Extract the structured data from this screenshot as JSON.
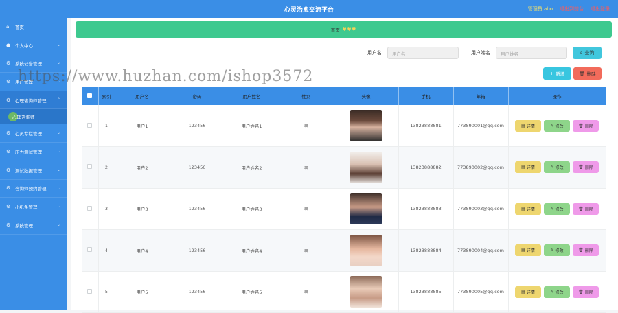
{
  "header": {
    "title": "心灵治愈交流平台",
    "admin": "管理员 abo",
    "link1": "退出到前台",
    "link2": "退出登录"
  },
  "sidebar": {
    "items": [
      {
        "label": "首页",
        "icon": "home-icon"
      },
      {
        "label": "个人中心",
        "icon": "user-icon"
      },
      {
        "label": "系统公告管理",
        "icon": "gear-icon"
      },
      {
        "label": "用户管理",
        "icon": "gear-icon"
      },
      {
        "label": "心理咨询师管理",
        "icon": "gear-icon"
      }
    ],
    "sub_item": "心理咨询师",
    "items_after": [
      {
        "label": "心灵专栏管理",
        "icon": "gear-icon"
      },
      {
        "label": "压力测试管理",
        "icon": "gear-icon"
      },
      {
        "label": "测试数据管理",
        "icon": "gear-icon"
      },
      {
        "label": "咨询师预约管理",
        "icon": "gear-icon"
      },
      {
        "label": "小纸条管理",
        "icon": "gear-icon"
      },
      {
        "label": "系统管理",
        "icon": "gear-icon"
      }
    ]
  },
  "breadcrumb": {
    "label": "首页"
  },
  "search": {
    "username_label": "用户名",
    "username_placeholder": "用户名",
    "name_label": "用户姓名",
    "name_placeholder": "用户姓名",
    "query_button": "查询"
  },
  "toolbar": {
    "add": "新增",
    "delete": "删除"
  },
  "watermark": "https://www.huzhan.com/ishop3572",
  "table": {
    "headers": [
      "",
      "索引",
      "用户名",
      "密码",
      "用户姓名",
      "性别",
      "头像",
      "手机",
      "邮箱",
      "操作"
    ],
    "op_labels": {
      "detail": "详情",
      "edit": "修改",
      "delete": "删除"
    },
    "rows": [
      {
        "index": "1",
        "username": "用户1",
        "password": "123456",
        "name": "用户姓名1",
        "gender": "男",
        "phone": "13823888881",
        "email": "773890001@qq.com"
      },
      {
        "index": "2",
        "username": "用户2",
        "password": "123456",
        "name": "用户姓名2",
        "gender": "男",
        "phone": "13823888882",
        "email": "773890002@qq.com"
      },
      {
        "index": "3",
        "username": "用户3",
        "password": "123456",
        "name": "用户姓名3",
        "gender": "男",
        "phone": "13823888883",
        "email": "773890003@qq.com"
      },
      {
        "index": "4",
        "username": "用户4",
        "password": "123456",
        "name": "用户姓名4",
        "gender": "男",
        "phone": "13823888884",
        "email": "773890004@qq.com"
      },
      {
        "index": "5",
        "username": "用户5",
        "password": "123456",
        "name": "用户姓名5",
        "gender": "男",
        "phone": "13823888885",
        "email": "773890005@qq.com"
      }
    ]
  },
  "colors": {
    "primary": "#3a8ee6",
    "breadcrumb": "#3ec98f",
    "detail": "#eed66f",
    "edit": "#8ed58a",
    "delete": "#ef9ae9"
  }
}
